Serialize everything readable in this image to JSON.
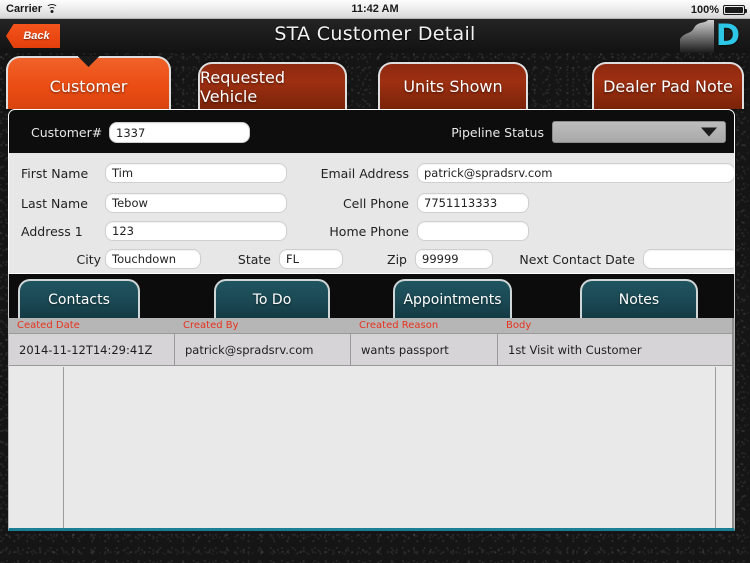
{
  "status_bar": {
    "carrier": "Carrier",
    "wifi_icon": "wifi-icon",
    "time": "11:42 AM",
    "battery_percent": "100%",
    "battery_icon": "battery-full-icon"
  },
  "nav_bar": {
    "back_label": "Back",
    "title": "STA Customer Detail",
    "logo_letter": "D",
    "logo_icon": "cloud-logo-icon"
  },
  "top_tabs": [
    {
      "label": "Customer",
      "active": true
    },
    {
      "label": "Requested Vehicle",
      "active": false
    },
    {
      "label": "Units Shown",
      "active": false
    },
    {
      "label": "Dealer Pad Note",
      "active": false
    }
  ],
  "form": {
    "customer_number": {
      "label": "Customer#",
      "value": "1337",
      "placeholder": ""
    },
    "pipeline_status": {
      "label": "Pipeline Status",
      "value": "",
      "placeholder": ""
    },
    "first_name": {
      "label": "First Name",
      "value": "Tim",
      "placeholder": ""
    },
    "last_name": {
      "label": "Last Name",
      "value": "Tebow",
      "placeholder": ""
    },
    "address_1": {
      "label": "Address 1",
      "value": "123",
      "placeholder": ""
    },
    "city": {
      "label": "City",
      "value": "Touchdown",
      "placeholder": ""
    },
    "state": {
      "label": "State",
      "value": "FL",
      "placeholder": ""
    },
    "zip": {
      "label": "Zip",
      "value": "99999",
      "placeholder": ""
    },
    "email_address": {
      "label": "Email Address",
      "value": "patrick@spradsrv.com",
      "placeholder": ""
    },
    "cell_phone": {
      "label": "Cell Phone",
      "value": "7751113333",
      "placeholder": ""
    },
    "home_phone": {
      "label": "Home Phone",
      "value": "",
      "placeholder": ""
    },
    "next_contact_date": {
      "label": "Next Contact Date",
      "value": "",
      "placeholder": ""
    }
  },
  "bottom_tabs": [
    {
      "label": "Contacts",
      "active": true
    },
    {
      "label": "To Do",
      "active": false
    },
    {
      "label": "Appointments",
      "active": false
    },
    {
      "label": "Notes",
      "active": false
    }
  ],
  "table": {
    "columns": [
      "Ceated Date",
      "Created By",
      "Created Reason",
      "Body"
    ],
    "rows": [
      [
        "2014-11-12T14:29:41Z",
        "patrick@spradsrv.com",
        "wants passport",
        "1st Visit with Customer"
      ]
    ]
  },
  "colors": {
    "accent_orange": "#ec4d13",
    "tab_inactive_red": "#9e2f11",
    "teal_tab": "#1b4a55",
    "teal_rule": "#1b7f93",
    "logo_cyan": "#2ec6e6",
    "header_text_red": "#e8321c",
    "panel_gray": "#e7e7e7",
    "row_gray": "#d6d4d6"
  }
}
